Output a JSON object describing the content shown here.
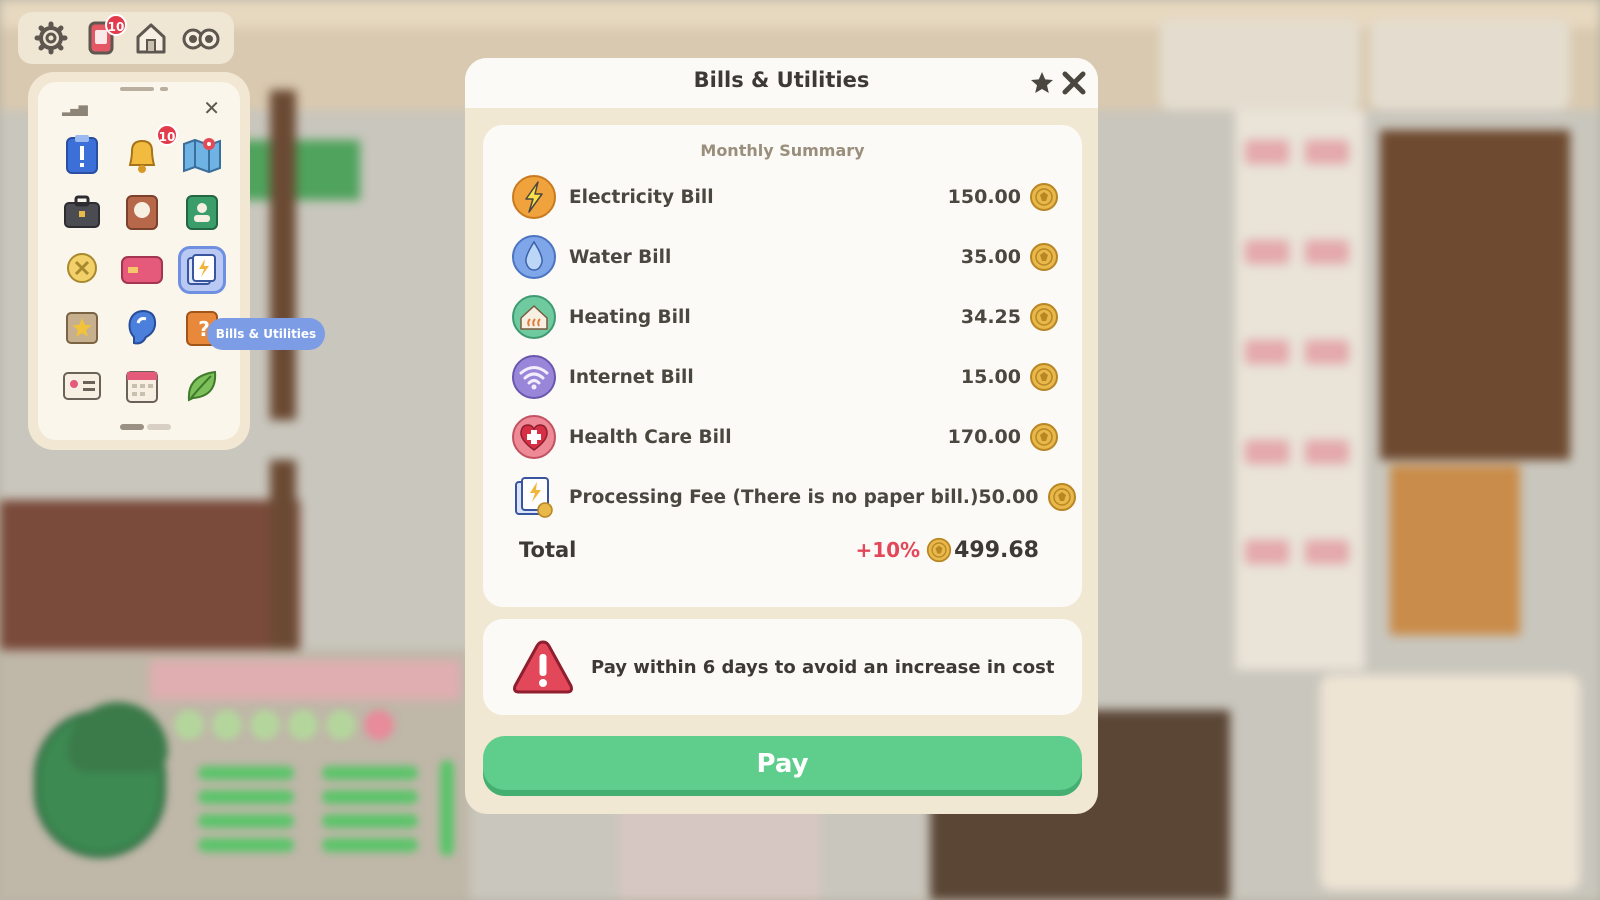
{
  "modal": {
    "title": "Bills & Utilities",
    "summary_heading": "Monthly Summary",
    "bills": [
      {
        "name": "Electricity Bill",
        "amount": "150.00",
        "icon": "lightning-icon"
      },
      {
        "name": "Water Bill",
        "amount": "35.00",
        "icon": "water-drop-icon"
      },
      {
        "name": "Heating Bill",
        "amount": "34.25",
        "icon": "house-heat-icon"
      },
      {
        "name": "Internet Bill",
        "amount": "15.00",
        "icon": "wifi-icon"
      },
      {
        "name": "Health Care Bill",
        "amount": "170.00",
        "icon": "heart-cross-icon"
      },
      {
        "name": "Processing Fee (There is no paper bill.)",
        "amount": "50.00",
        "icon": "bill-card-icon"
      }
    ],
    "total_label": "Total",
    "total_increase": "+10%",
    "total_amount": "499.68",
    "warning_text": "Pay within 6 days to avoid an increase in cost",
    "pay_label": "Pay"
  },
  "hud": {
    "topbar": [
      {
        "icon": "gear-icon"
      },
      {
        "icon": "phone-icon",
        "badge": "10"
      },
      {
        "icon": "home-icon"
      },
      {
        "icon": "binoculars-icon"
      }
    ],
    "phone_apps": [
      {
        "icon": "clipboard-alert-icon"
      },
      {
        "icon": "bell-icon",
        "badge": "10"
      },
      {
        "icon": "map-icon"
      },
      {
        "icon": "briefcase-icon"
      },
      {
        "icon": "recipe-book-icon"
      },
      {
        "icon": "contacts-book-icon"
      },
      {
        "icon": "skill-bulb-icon"
      },
      {
        "icon": "credit-card-icon"
      },
      {
        "icon": "bills-icon",
        "selected": true
      },
      {
        "icon": "star-badge-icon"
      },
      {
        "icon": "ear-icon"
      },
      {
        "icon": "help-book-icon"
      },
      {
        "icon": "id-card-icon"
      },
      {
        "icon": "calendar-icon"
      },
      {
        "icon": "leaf-icon"
      }
    ],
    "tooltip": "Bills & Utilities"
  },
  "colors": {
    "accent_green": "#5fcd8c",
    "warning_red": "#e2475a",
    "coin_gold": "#e8b84a",
    "panel_cream": "#f1e8d4"
  }
}
